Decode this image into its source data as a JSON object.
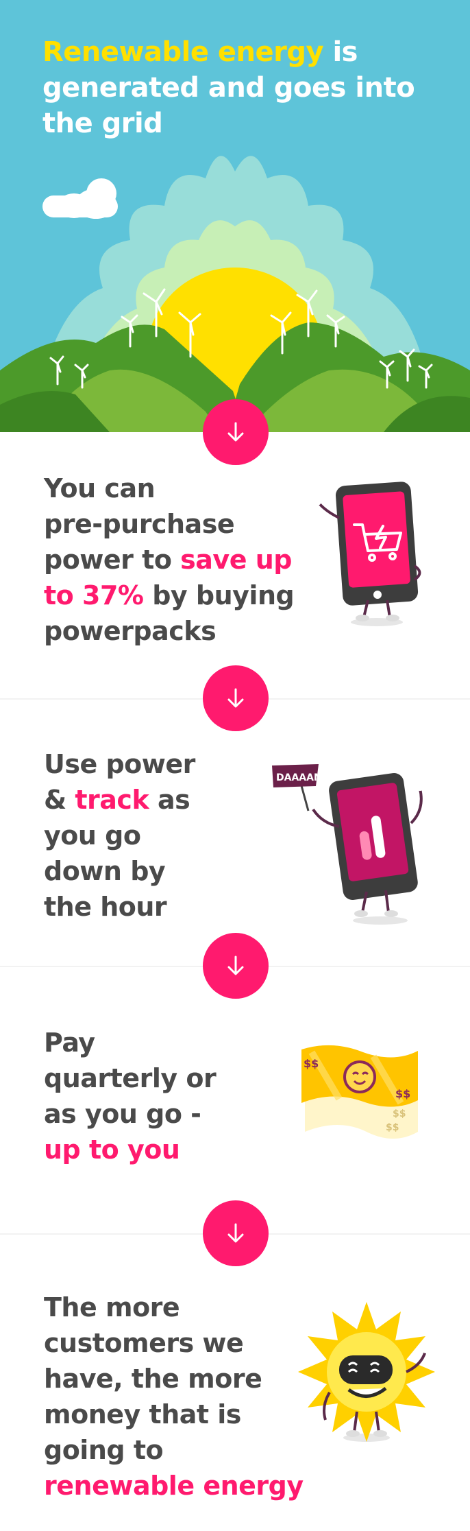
{
  "hero": {
    "title_highlight": "Renewable energy",
    "title_line1_rest": " is",
    "title_line2": "generated and goes into",
    "title_line3": "the grid"
  },
  "steps": [
    {
      "line1": "You can",
      "line2": "pre-purchase",
      "line3_plain": "power to ",
      "line3_pink": "save up",
      "line4_pink": "to 37%",
      "line4_plain": " by buying",
      "line5": "powerpacks"
    },
    {
      "line1": "Use power",
      "line2_plain_a": "& ",
      "line2_pink": "track",
      "line2_plain_b": " as",
      "line3": "you go",
      "line4": "down by",
      "line5": "the hour",
      "flag_text": "DAAAAM"
    },
    {
      "line1": "Pay",
      "line2": "quarterly or",
      "line3": "as you go -",
      "line4_pink": "up to you",
      "bill_symbol": "$$"
    },
    {
      "line1": "The more",
      "line2": "customers we",
      "line3": "have, the more",
      "line4": "money that is",
      "line5": "going to",
      "line6_pink": "renewable energy"
    }
  ],
  "icons": {
    "arrow": "arrow-down-icon",
    "cloud": "cloud-icon",
    "phone_cart": "phone-cart-mascot",
    "phone_bars": "phone-bars-mascot",
    "banknote": "banknote-mascot",
    "sun": "sun-mascot"
  },
  "colors": {
    "sky": "#5ec4d9",
    "sun": "#ffe000",
    "accent_pink": "#ff1a6e",
    "text_dark": "#4a4a4a",
    "hill_green": "#4c9a2a"
  }
}
